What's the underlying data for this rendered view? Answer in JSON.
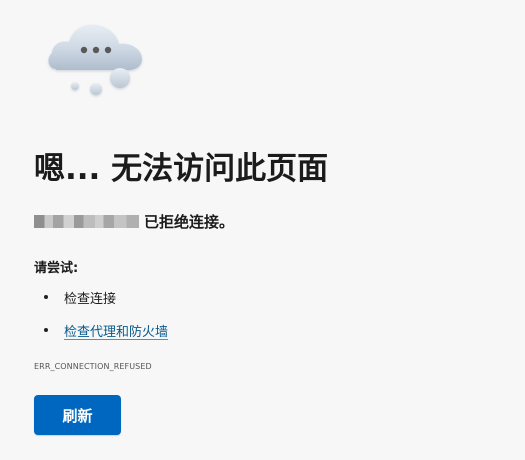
{
  "error_page": {
    "title": "嗯... 无法访问此页面",
    "refused_message": "已拒绝连接。",
    "try_title": "请尝试:",
    "suggestions": [
      {
        "label": "检查连接"
      },
      {
        "label": "检查代理和防火墙"
      }
    ],
    "error_code": "ERR_CONNECTION_REFUSED",
    "refresh_label": "刷新"
  },
  "illustration": {
    "icon": "cloud-dots-icon"
  },
  "colors": {
    "background": "#f7f7f7",
    "text": "#1b1b1b",
    "link": "#075b8c",
    "button": "#0067c0",
    "button_text": "#ffffff"
  }
}
